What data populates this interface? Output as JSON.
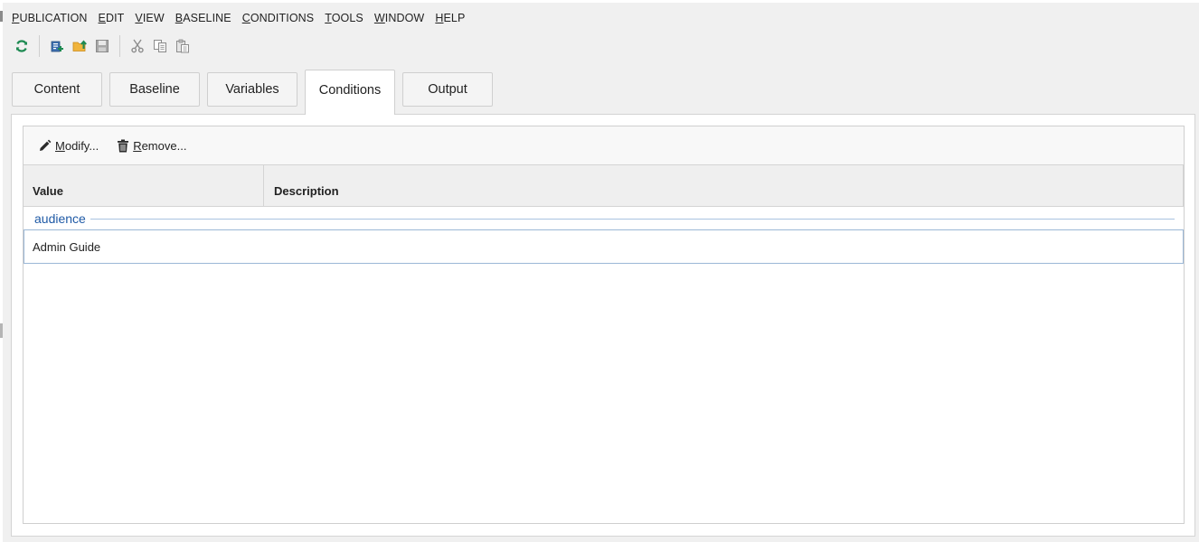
{
  "menubar": {
    "items": [
      {
        "accel": "P",
        "rest": "UBLICATION"
      },
      {
        "accel": "E",
        "rest": "DIT"
      },
      {
        "accel": "V",
        "rest": "IEW"
      },
      {
        "accel": "B",
        "rest": "ASELINE"
      },
      {
        "accel": "C",
        "rest": "ONDITIONS"
      },
      {
        "accel": "T",
        "rest": "OOLS"
      },
      {
        "accel": "W",
        "rest": "INDOW"
      },
      {
        "accel": "H",
        "rest": "ELP"
      }
    ]
  },
  "toolbar": {
    "icons": [
      "refresh-icon",
      "new-publication-icon",
      "open-folder-icon",
      "save-icon",
      "cut-icon",
      "copy-icon",
      "paste-icon"
    ]
  },
  "tabs": [
    {
      "label": "Content",
      "active": false
    },
    {
      "label": "Baseline",
      "active": false
    },
    {
      "label": "Variables",
      "active": false
    },
    {
      "label": "Conditions",
      "active": true
    },
    {
      "label": "Output",
      "active": false
    }
  ],
  "actions": {
    "modify": {
      "accel": "M",
      "rest": "odify..."
    },
    "remove": {
      "accel": "R",
      "rest": "emove..."
    }
  },
  "table": {
    "columns": {
      "value": "Value",
      "description": "Description"
    },
    "groups": [
      {
        "name": "audience",
        "rows": [
          {
            "value": "Admin Guide",
            "description": ""
          }
        ]
      }
    ]
  },
  "colors": {
    "group_label": "#1f5aa6",
    "refresh_icon": "#1e8a52",
    "selection_border": "#9bb7d6"
  }
}
